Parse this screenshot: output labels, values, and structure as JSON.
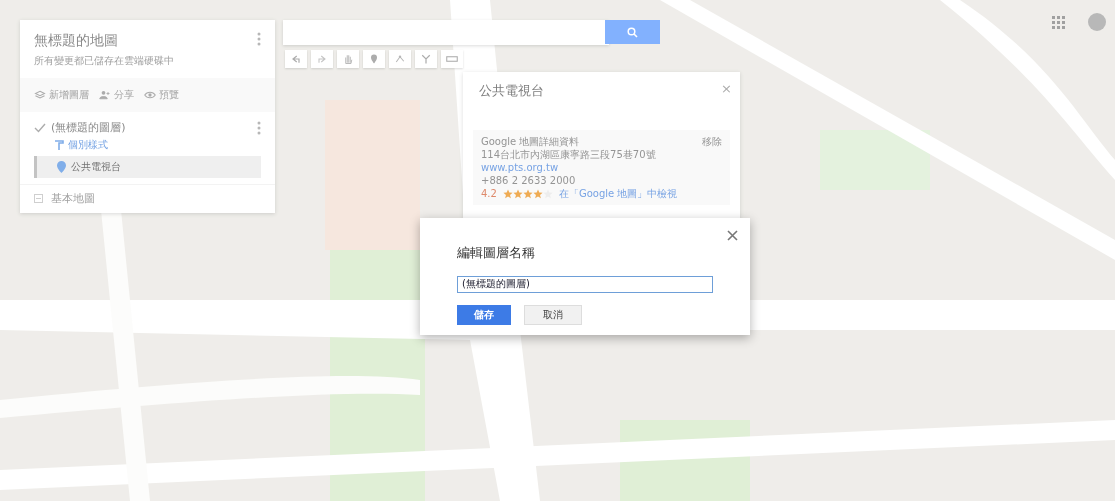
{
  "map_panel": {
    "title": "無標題的地圖",
    "status": "所有變更都已儲存在雲端硬碟中",
    "actions": [
      {
        "kind": "add-layer",
        "label": "新增圖層"
      },
      {
        "kind": "share",
        "label": "分享"
      },
      {
        "kind": "preview",
        "label": "預覽"
      }
    ],
    "layer": {
      "name": "(無標題的圖層)",
      "checked": true,
      "style_link": "個別樣式",
      "places": [
        {
          "name": "公共電視台",
          "selected": true
        }
      ]
    },
    "base_map": {
      "label": "基本地圖"
    }
  },
  "toolbar": {
    "tools": [
      {
        "kind": "undo"
      },
      {
        "kind": "redo"
      },
      {
        "kind": "hand"
      },
      {
        "kind": "marker"
      },
      {
        "kind": "line"
      },
      {
        "kind": "route"
      },
      {
        "kind": "ruler"
      }
    ]
  },
  "info_card": {
    "title": "公共電視台",
    "close": "×",
    "details_heading": "Google 地圖詳細資料",
    "remove": "移除",
    "address": "114台北市內湖區康寧路三段75巷70號",
    "website": "www.pts.org.tw",
    "phone": "+886 2 2633 2000",
    "rating": "4.2",
    "stars": 4,
    "view_link": "在「Google 地圖」中檢視"
  },
  "dialog": {
    "title": "編輯圖層名稱",
    "value": "(無標題的圖層)",
    "buttons": [
      {
        "label": "儲存",
        "kind": "primary"
      },
      {
        "label": "取消",
        "kind": "secondary"
      }
    ]
  }
}
